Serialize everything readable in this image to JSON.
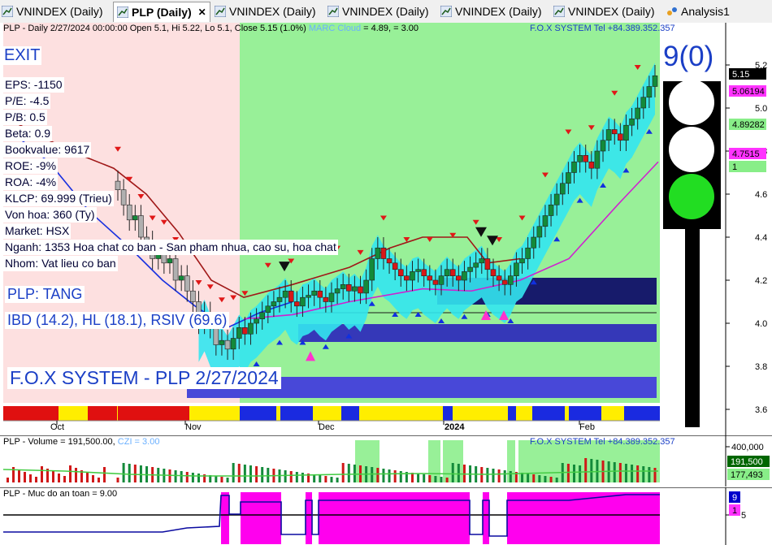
{
  "tabs": [
    {
      "label": "VNINDEX (Daily)",
      "active": false
    },
    {
      "label": "PLP (Daily)",
      "active": true
    },
    {
      "label": "VNINDEX (Daily)",
      "active": false
    },
    {
      "label": "VNINDEX (Daily)",
      "active": false
    },
    {
      "label": "VNINDEX (Daily)",
      "active": false
    },
    {
      "label": "VNINDEX (Daily)",
      "active": false
    },
    {
      "label": "Analysis1",
      "active": false
    }
  ],
  "tab_close": "✕",
  "price_pane": {
    "header": "PLP - Daily 2/27/2024 00:00:00 Open 5.1, Hi 5.22, Lo 5.1, Close 5.15 (1.0%)",
    "cloud_label": "MARC Cloud",
    "cloud_values": "= 4.89,    = 3.00",
    "system_tel": "F.O.X SYSTEM Tel +84.389.352.357",
    "signal_count": "9(0)",
    "exit_label": "EXIT",
    "fundamentals": [
      "EPS: -1150",
      "P/E: -4.5",
      "P/B: 0.5",
      "Beta: 0.9",
      "Bookvalue: 9617",
      "ROE: -9%",
      "ROA: -4%",
      "KLCP: 69.999 (Trieu)",
      "Von hoa: 360 (Ty)",
      "Market: HSX",
      "Nganh: 1353 Hoa chat co ban - San pham nhua, cao su, hoa chat",
      "Nhom: Vat lieu co ban"
    ],
    "trend": "PLP: TANG",
    "indicators": "IBD (14.2), HL (18.1), RSIV (69.6)",
    "watermark": "F.O.X SYSTEM - PLP 2/27/2024",
    "y_ticks": [
      "5.2",
      "5.0",
      "4.8",
      "4.6",
      "4.4",
      "4.2",
      "4.0",
      "3.8",
      "3.6"
    ],
    "x_labels": [
      "Oct",
      "Nov",
      "Dec",
      "2024",
      "Feb"
    ],
    "value_tags": [
      {
        "text": "5.15",
        "bg": "#000000",
        "fg": "#ffffff"
      },
      {
        "text": "5.06194",
        "bg": "#ff33ff",
        "fg": "#000000"
      },
      {
        "text": "4.89282",
        "bg": "#88ee88",
        "fg": "#000000"
      },
      {
        "text": "4.7515",
        "bg": "#ff33ff",
        "fg": "#000000"
      },
      {
        "text": "1",
        "bg": "#88ee88",
        "fg": "#000000"
      }
    ],
    "traffic_light": [
      "white",
      "white",
      "green"
    ]
  },
  "volume_pane": {
    "header": "PLP - Volume = 191,500.00,",
    "czi": "CZI = 3.00",
    "system_tel": "F.O.X SYSTEM Tel +84.389.352.357",
    "y_tick": "400,000",
    "tags": [
      {
        "text": "191,500",
        "bg": "#006600",
        "fg": "#ffffff"
      },
      {
        "text": "177,493",
        "bg": "#88ee88",
        "fg": "#000000"
      }
    ]
  },
  "safety_pane": {
    "header": "PLP - Muc do an toan = 9.00",
    "y_tick": "5",
    "tags": [
      {
        "text": "9",
        "bg": "#0000cc",
        "fg": "#ffffff"
      },
      {
        "text": "1",
        "bg": "#ff33ff",
        "fg": "#000000"
      }
    ]
  },
  "chart_data": {
    "type": "candlestick",
    "title": "PLP - Daily",
    "x_labels": [
      "Oct",
      "Nov",
      "Dec",
      "2024",
      "Feb"
    ],
    "ylim": [
      3.55,
      5.25
    ],
    "series": [
      {
        "name": "PLP",
        "values": [
          4.62,
          4.55,
          4.48,
          4.5,
          4.4,
          4.38,
          4.3,
          4.33,
          4.28,
          4.3,
          4.2,
          4.22,
          4.15,
          4.1,
          4.0,
          4.05,
          3.98,
          3.9,
          3.92,
          3.88,
          3.93,
          3.98,
          3.95,
          4.0,
          4.02,
          4.05,
          4.08,
          4.1,
          4.12,
          4.15,
          4.1,
          4.08,
          4.12,
          4.13,
          4.15,
          4.12,
          4.1,
          4.14,
          4.16,
          4.18,
          4.15,
          4.17,
          4.14,
          4.2,
          4.3,
          4.35,
          4.3,
          4.28,
          4.25,
          4.22,
          4.2,
          4.24,
          4.25,
          4.22,
          4.2,
          4.18,
          4.22,
          4.25,
          4.22,
          4.2,
          4.24,
          4.26,
          4.28,
          4.3,
          4.25,
          4.22,
          4.2,
          4.18,
          4.22,
          4.28,
          4.3,
          4.35,
          4.4,
          4.45,
          4.5,
          4.55,
          4.6,
          4.65,
          4.7,
          4.75,
          4.78,
          4.75,
          4.72,
          4.8,
          4.85,
          4.9,
          4.88,
          4.85,
          4.92,
          4.95,
          5.0,
          5.05,
          5.1,
          5.15
        ]
      }
    ]
  }
}
